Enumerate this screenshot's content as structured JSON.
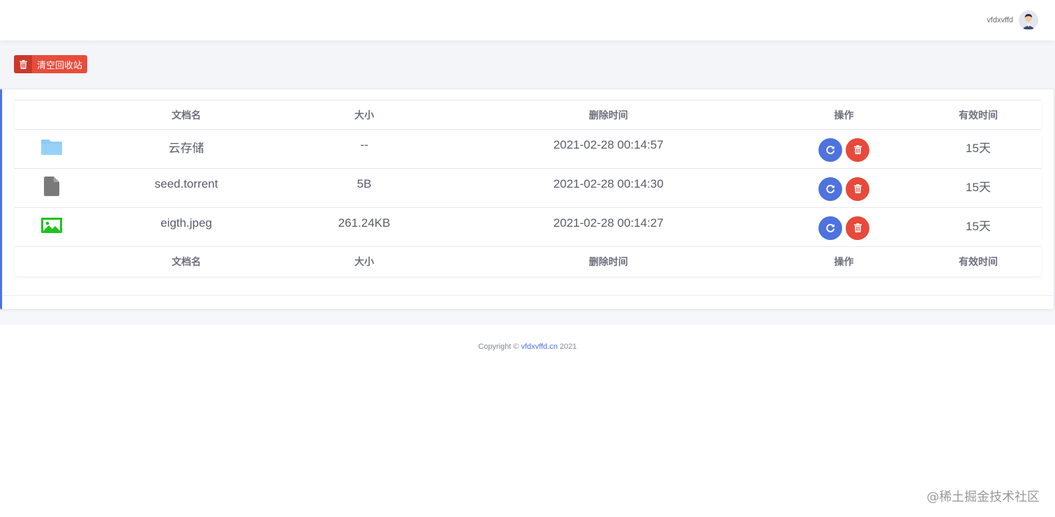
{
  "header": {
    "username": "vfdxvffd"
  },
  "toolbar": {
    "clear_label": "清空回收站"
  },
  "table": {
    "columns": [
      "文档名",
      "大小",
      "删除时间",
      "操作",
      "有效时间"
    ],
    "rows": [
      {
        "type": "folder",
        "name": "云存储",
        "size": "--",
        "deleted_at": "2021-02-28 00:14:57",
        "valid": "15天"
      },
      {
        "type": "file",
        "name": "seed.torrent",
        "size": "5B",
        "deleted_at": "2021-02-28 00:14:30",
        "valid": "15天"
      },
      {
        "type": "image",
        "name": "eigth.jpeg",
        "size": "261.24KB",
        "deleted_at": "2021-02-28 00:14:27",
        "valid": "15天"
      }
    ]
  },
  "footer": {
    "prefix": "Copyright © ",
    "link": "vfdxvffd.cn",
    "suffix": " 2021"
  },
  "watermark": "@稀土掘金技术社区",
  "colors": {
    "primary": "#4e73df",
    "danger": "#e74a3b",
    "folder": "#8ccbf7",
    "file": "#7a7a7a",
    "image": "#1ec31e"
  }
}
